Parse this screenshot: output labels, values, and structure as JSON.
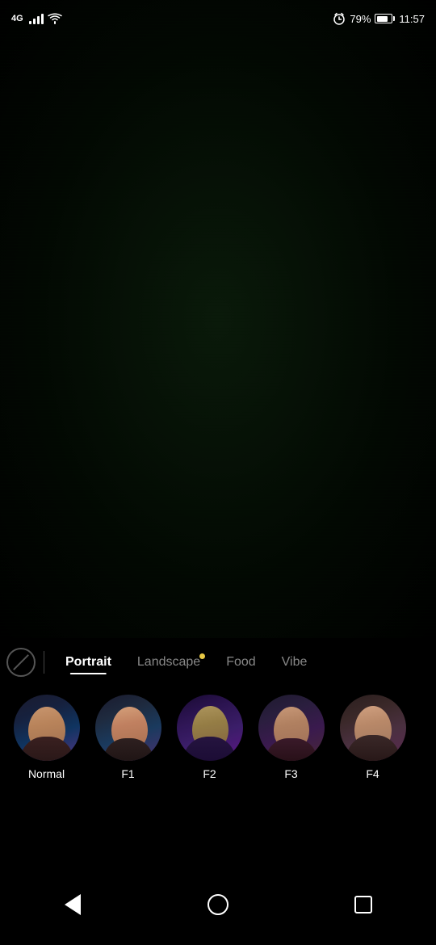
{
  "statusBar": {
    "lte": "4G",
    "battery_percent": "79%",
    "time": "11:57"
  },
  "filterTabs": {
    "items": [
      {
        "label": "Portrait",
        "active": true,
        "dot": false
      },
      {
        "label": "Landscape",
        "active": false,
        "dot": true
      },
      {
        "label": "Food",
        "active": false,
        "dot": false
      },
      {
        "label": "Vibe",
        "active": false,
        "dot": false
      }
    ]
  },
  "filterOptions": {
    "items": [
      {
        "label": "Normal",
        "face": "normal"
      },
      {
        "label": "F1",
        "face": "f1"
      },
      {
        "label": "F2",
        "face": "f2"
      },
      {
        "label": "F3",
        "face": "f3"
      },
      {
        "label": "F4",
        "face": "f4"
      }
    ]
  },
  "navBar": {
    "back": "back",
    "home": "home",
    "recent": "recent"
  }
}
